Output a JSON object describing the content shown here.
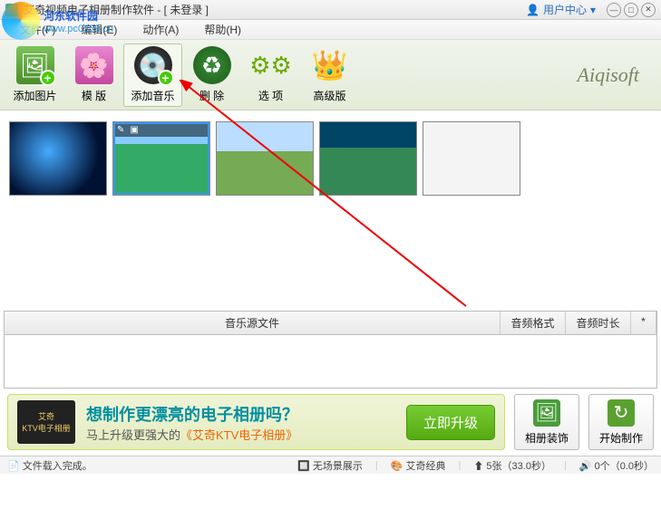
{
  "titlebar": {
    "title": "艾奇视频电子相册制作软件 - [ 未登录 ]",
    "user_center": "用户中心",
    "arrow": "▾"
  },
  "menu": {
    "file": "文件(F)",
    "edit": "编辑(E)",
    "action": "动作(A)",
    "help": "帮助(H)"
  },
  "watermark": {
    "name": "河东软件园",
    "url": "www.pc0359.cn"
  },
  "toolbar": {
    "add_image": "添加图片",
    "template": "模 版",
    "add_music": "添加音乐",
    "delete": "删 除",
    "options": "选 项",
    "advanced": "高级版",
    "brand": "Aiqisoft"
  },
  "table": {
    "col_source": "音乐源文件",
    "col_format": "音频格式",
    "col_duration": "音频时长",
    "col_star": "*"
  },
  "ad": {
    "box_line1": "艾奇",
    "box_line2": "KTV电子相册",
    "line1": "想制作更漂亮的电子相册吗？",
    "line2_pre": "马上升级更强大的",
    "line2_hl": "《艾奇KTV电子相册》",
    "btn": "立即升级"
  },
  "buttons": {
    "decorate": "相册装饰",
    "start": "开始制作"
  },
  "status": {
    "load": "文件载入完成。",
    "no_bg": "无场景展示",
    "theme": "艾奇经典",
    "count": "5张（33.0秒）",
    "audio": "0个（0.0秒）"
  },
  "colors": {
    "img_green": "#5a9c3a",
    "template": "#d668b8",
    "music": "#333",
    "trash": "#2a6c28",
    "gear": "#6a0",
    "crown": "#e8a020",
    "decorate": "#4a9c3a",
    "start": "#5aa030"
  }
}
